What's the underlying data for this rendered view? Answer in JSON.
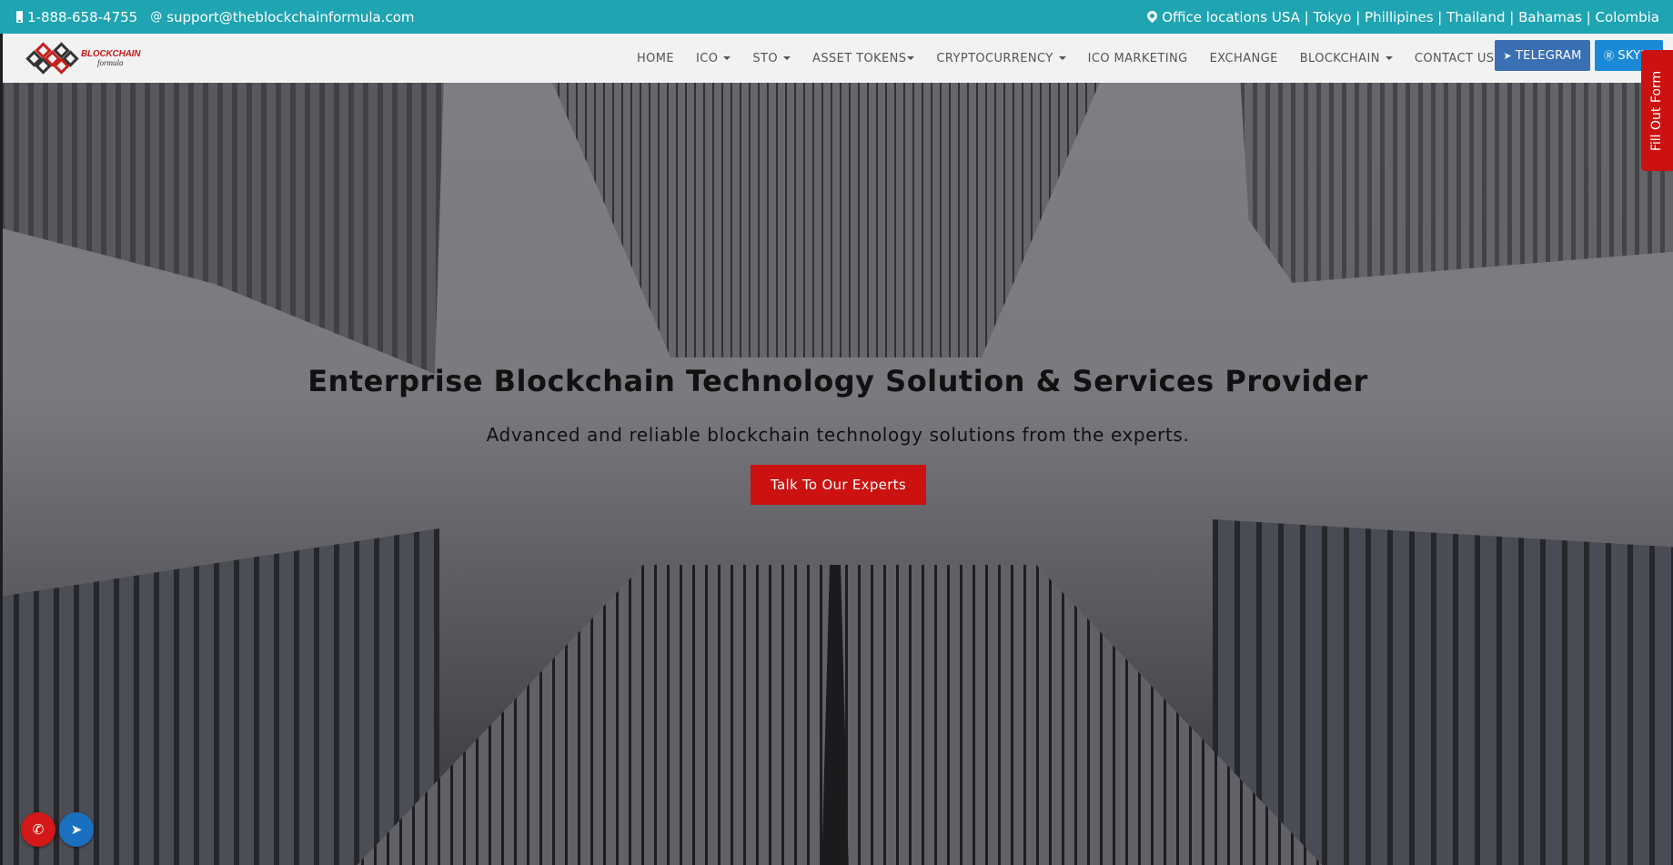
{
  "topbar": {
    "phone": "1-888-658-4755",
    "email": "support@theblockchainformula.com",
    "offices": "Office locations USA | Tokyo | Phillipines | Thailand | Bahamas | Colombia",
    "phone_icon": "mobile-phone-icon",
    "email_icon": "at-sign-icon",
    "location_icon": "map-pin-icon"
  },
  "logo": {
    "line1": "BLOCKCHAIN",
    "line2": "formula"
  },
  "nav": {
    "items": [
      {
        "label": "HOME"
      },
      {
        "label": "ICO"
      },
      {
        "label": "STO"
      },
      {
        "label": "ASSET TOKENS"
      },
      {
        "label": "CRYPTOCURRENCY"
      },
      {
        "label": "ICO MARKETING"
      },
      {
        "label": "EXCHANGE"
      },
      {
        "label": "BLOCKCHAIN"
      },
      {
        "label": "CONTACT US"
      }
    ],
    "telegram_label": "TELEGRAM",
    "skype_label": "SKYPE"
  },
  "side_tab": "Fill Out Form",
  "hero": {
    "title": "Enterprise Blockchain Technology Solution & Services Provider",
    "subtitle": "Advanced and reliable blockchain technology solutions from the experts.",
    "cta": "Talk To Our Experts"
  },
  "floating": {
    "whatsapp_icon": "whatsapp-icon",
    "telegram_icon": "telegram-icon"
  },
  "colors": {
    "topbar": "#1fa4b2",
    "accent_red": "#cc1111",
    "telegram_blue": "#3b6fb4",
    "skype_blue": "#1a8ad8"
  }
}
